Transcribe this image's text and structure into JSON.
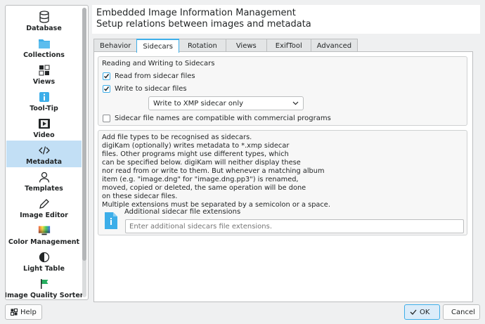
{
  "sidebar": {
    "items": [
      {
        "label": "Database",
        "icon": "database-icon"
      },
      {
        "label": "Collections",
        "icon": "folder-icon"
      },
      {
        "label": "Views",
        "icon": "views-grid-icon"
      },
      {
        "label": "Tool-Tip",
        "icon": "info-icon"
      },
      {
        "label": "Video",
        "icon": "video-icon"
      },
      {
        "label": "Metadata",
        "icon": "code-icon"
      },
      {
        "label": "Templates",
        "icon": "person-icon"
      },
      {
        "label": "Image Editor",
        "icon": "pencil-icon"
      },
      {
        "label": "Color Management",
        "icon": "color-monitor-icon"
      },
      {
        "label": "Light Table",
        "icon": "contrast-icon"
      },
      {
        "label": "Image Quality Sorter",
        "icon": "flag-icon"
      }
    ],
    "selected": "Metadata"
  },
  "header": {
    "title": "Embedded Image Information Management",
    "subtitle": "Setup relations between images and metadata"
  },
  "tabs": [
    "Behavior",
    "Sidecars",
    "Rotation",
    "Views",
    "ExifTool",
    "Advanced"
  ],
  "active_tab": "Sidecars",
  "sidecars": {
    "group_title": "Reading and Writing to Sidecars",
    "read_label": "Read from sidecar files",
    "read_checked": true,
    "write_label": "Write to sidecar files",
    "write_checked": true,
    "write_mode": "Write to XMP sidecar only",
    "compat_label": "Sidecar file names are compatible with commercial programs",
    "compat_checked": false,
    "description": "Add file types to be recognised as sidecars.\ndigiKam (optionally) writes metadata to *.xmp sidecar\nfiles. Other programs might use different types, which\ncan be specified below. digiKam will neither display these\nnor read from or write to them. But whenever a matching album\nitem (e.g. \"image.dng\" for \"image.dng.pp3\") is renamed,\nmoved, copied or deleted, the same operation will be done\non these sidecar files.\nMultiple extensions must be separated by a semicolon or a space.",
    "extensions_label": "Additional sidecar file extensions",
    "extensions_placeholder": "Enter additional sidecars file extensions.",
    "extensions_value": ""
  },
  "buttons": {
    "help": "Help",
    "ok": "OK",
    "cancel": "Cancel"
  },
  "colors": {
    "accent": "#3daee9",
    "selected_bg": "#c2dff5",
    "window_bg": "#eff0f1"
  }
}
